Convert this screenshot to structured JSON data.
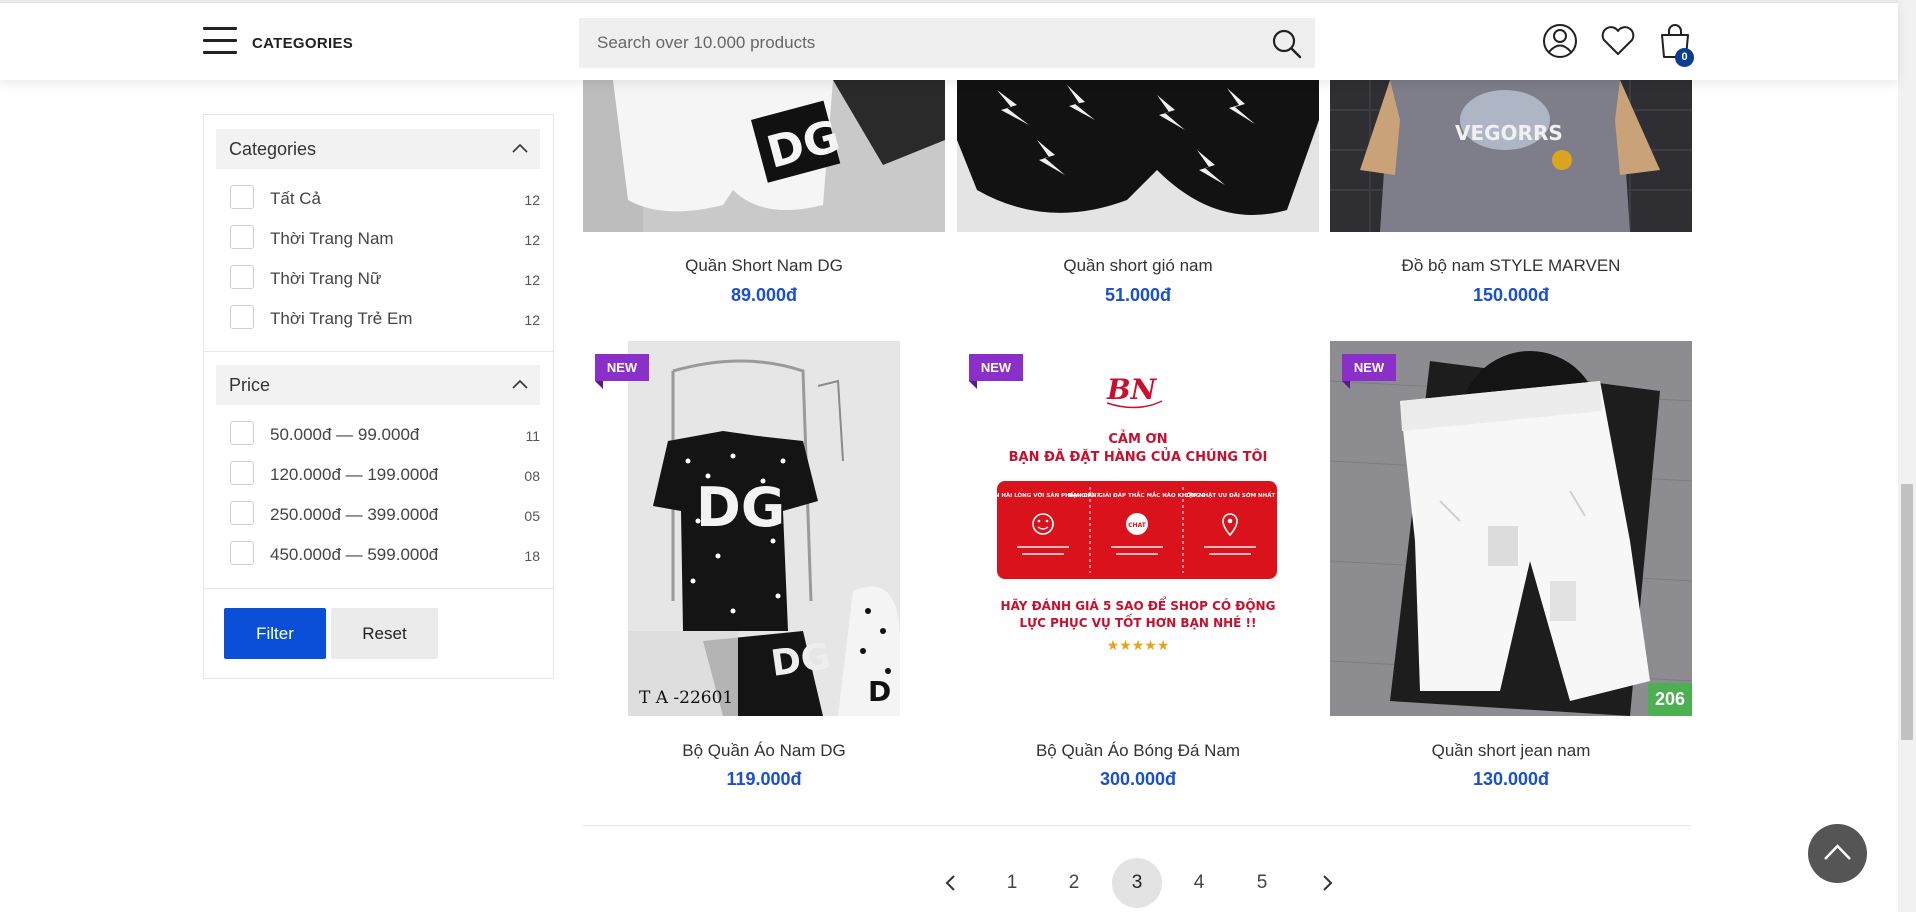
{
  "header": {
    "categories_label": "CATEGORIES",
    "search_placeholder": "Search over 10.000 products",
    "cart_count": "0"
  },
  "sidebar": {
    "categories": {
      "title": "Categories",
      "options": [
        {
          "label": "Tất Cả",
          "count": "12"
        },
        {
          "label": "Thời Trang Nam",
          "count": "12"
        },
        {
          "label": "Thời Trang Nữ",
          "count": "12"
        },
        {
          "label": "Thời Trang Trẻ Em",
          "count": "12"
        }
      ]
    },
    "price": {
      "title": "Price",
      "options": [
        {
          "label": "50.000đ — 99.000đ",
          "count": "11"
        },
        {
          "label": "120.000đ — 199.000đ",
          "count": "08"
        },
        {
          "label": "250.000đ — 399.000đ",
          "count": "05"
        },
        {
          "label": "450.000đ — 599.000đ",
          "count": "18"
        }
      ]
    },
    "filter_button": "Filter",
    "reset_button": "Reset"
  },
  "products": [
    {
      "name": "Quần Short Nam DG",
      "price": "89.000đ"
    },
    {
      "name": "Quần short gió nam",
      "price": "51.000đ"
    },
    {
      "name": "Đồ bộ nam STYLE MARVEN",
      "price": "150.000đ"
    },
    {
      "name": "Bộ Quần Áo Nam DG",
      "price": "119.000đ",
      "badge": "NEW",
      "image_text": "T A -22601"
    },
    {
      "name": "Bộ Quần Áo Bóng Đá Nam",
      "price": "300.000đ",
      "badge": "NEW",
      "image_text": {
        "thanks_1": "CẢM ƠN",
        "thanks_2": "BẠN ĐÃ ĐẶT HÀNG CỦA CHÚNG TÔI",
        "card_1": "BẠN HÀI LÒNG VỚI SẢN PHẨM CHỨ ?",
        "card_2": "BẠN CẦN GIẢI ĐÁP THẮC MẮC NÀO KHÔNG ?",
        "card_3": "CẬP NHẬT ƯU ĐÃI SỚM NHẤT",
        "chat": "CHAT",
        "rate_1": "HÃY ĐÁNH GIÁ 5 SAO ĐỂ SHOP CÓ ĐỘNG",
        "rate_2": "LỰC PHỤC VỤ TỐT HƠN BẠN NHÉ !!",
        "stars": "★★★★★"
      }
    },
    {
      "name": "Quần short jean nam",
      "price": "130.000đ",
      "badge": "NEW",
      "image_count": "206"
    }
  ],
  "pagination": {
    "pages": [
      "1",
      "2",
      "3",
      "4",
      "5"
    ],
    "current": "3"
  },
  "colors": {
    "accent_blue": "#0a4fd8",
    "price_blue": "#1a4fd0",
    "new_badge": "#8b2fc9",
    "count_badge": "#4caf50"
  }
}
